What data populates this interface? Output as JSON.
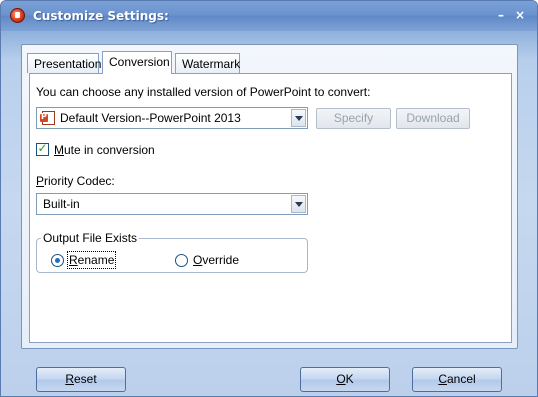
{
  "window": {
    "title": "Customize Settings:",
    "minimize_glyph": "–",
    "close_glyph": "×"
  },
  "tabs": [
    {
      "label": "Presentation",
      "active": false
    },
    {
      "label": "Conversion",
      "active": true
    },
    {
      "label": "Watermark",
      "active": false
    }
  ],
  "conversion": {
    "choose_text": "You can choose any installed version of PowerPoint to convert:",
    "version_select": {
      "value": "Default Version--PowerPoint 2013",
      "icon": "powerpoint-icon"
    },
    "specify_label": "Specify",
    "download_label": "Download",
    "mute": {
      "label_first": "M",
      "label_rest": "ute in conversion",
      "checked": true
    },
    "priority_codec_label_first": "P",
    "priority_codec_label_rest": "riority Codec:",
    "codec_select": {
      "value": "Built-in"
    },
    "output_group": {
      "title": "Output File Exists",
      "rename_first": "R",
      "rename_rest": "ename",
      "override_first": "O",
      "override_rest": "verride",
      "selected": "rename"
    }
  },
  "footer": {
    "reset_first": "R",
    "reset_rest": "eset",
    "ok_first": "O",
    "ok_rest": "K",
    "cancel_first": "C",
    "cancel_rest": "ancel"
  },
  "colors": {
    "title_bar": "#6b93cf",
    "checkmark": "#21a121",
    "radio_dot": "#1f6fc7"
  }
}
